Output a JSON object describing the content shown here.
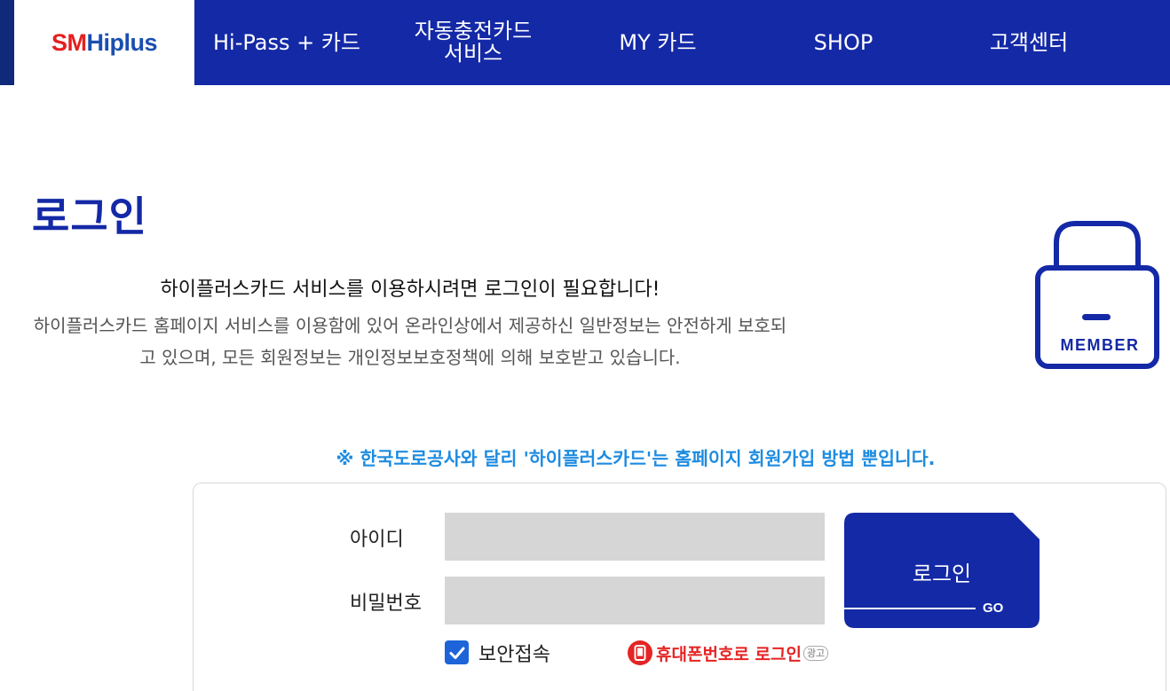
{
  "header": {
    "logo": {
      "part1": "SM",
      "part2": "Hiplus"
    },
    "nav": [
      {
        "label": "Hi-Pass + 카드"
      },
      {
        "line1": "자동충전카드",
        "line2": "서비스"
      },
      {
        "label": "MY 카드"
      },
      {
        "label": "SHOP"
      },
      {
        "label": "고객센터"
      }
    ]
  },
  "main": {
    "title": "로그인",
    "intro_heading": "하이플러스카드 서비스를 이용하시려면 로그인이 필요합니다!",
    "intro_body": "하이플러스카드 홈페이지 서비스를 이용함에 있어 온라인상에서 제공하신 일반정보는 안전하게 보호되고 있으며, 모든 회원정보는 개인정보보호정책에 의해 보호받고 있습니다.",
    "lock_icon": {
      "icon": "lock-icon",
      "label": "MEMBER"
    },
    "notice": "※ 한국도로공사와 달리 '하이플러스카드'는 홈페이지 회원가입 방법 뿐입니다."
  },
  "login_form": {
    "id_label": "아이디",
    "id_value": "",
    "password_label": "비밀번호",
    "password_value": "",
    "login_button": "로그인",
    "go_label": "GO",
    "secure_label": "보안접속",
    "secure_checked": true,
    "phone_login": "휴대폰번호로 로그인",
    "ad_badge": "광고"
  },
  "colors": {
    "brand_navy": "#1429a6",
    "notice_blue": "#1e8ce0",
    "phone_red": "#e52424",
    "input_gray": "#d6d6d6"
  }
}
